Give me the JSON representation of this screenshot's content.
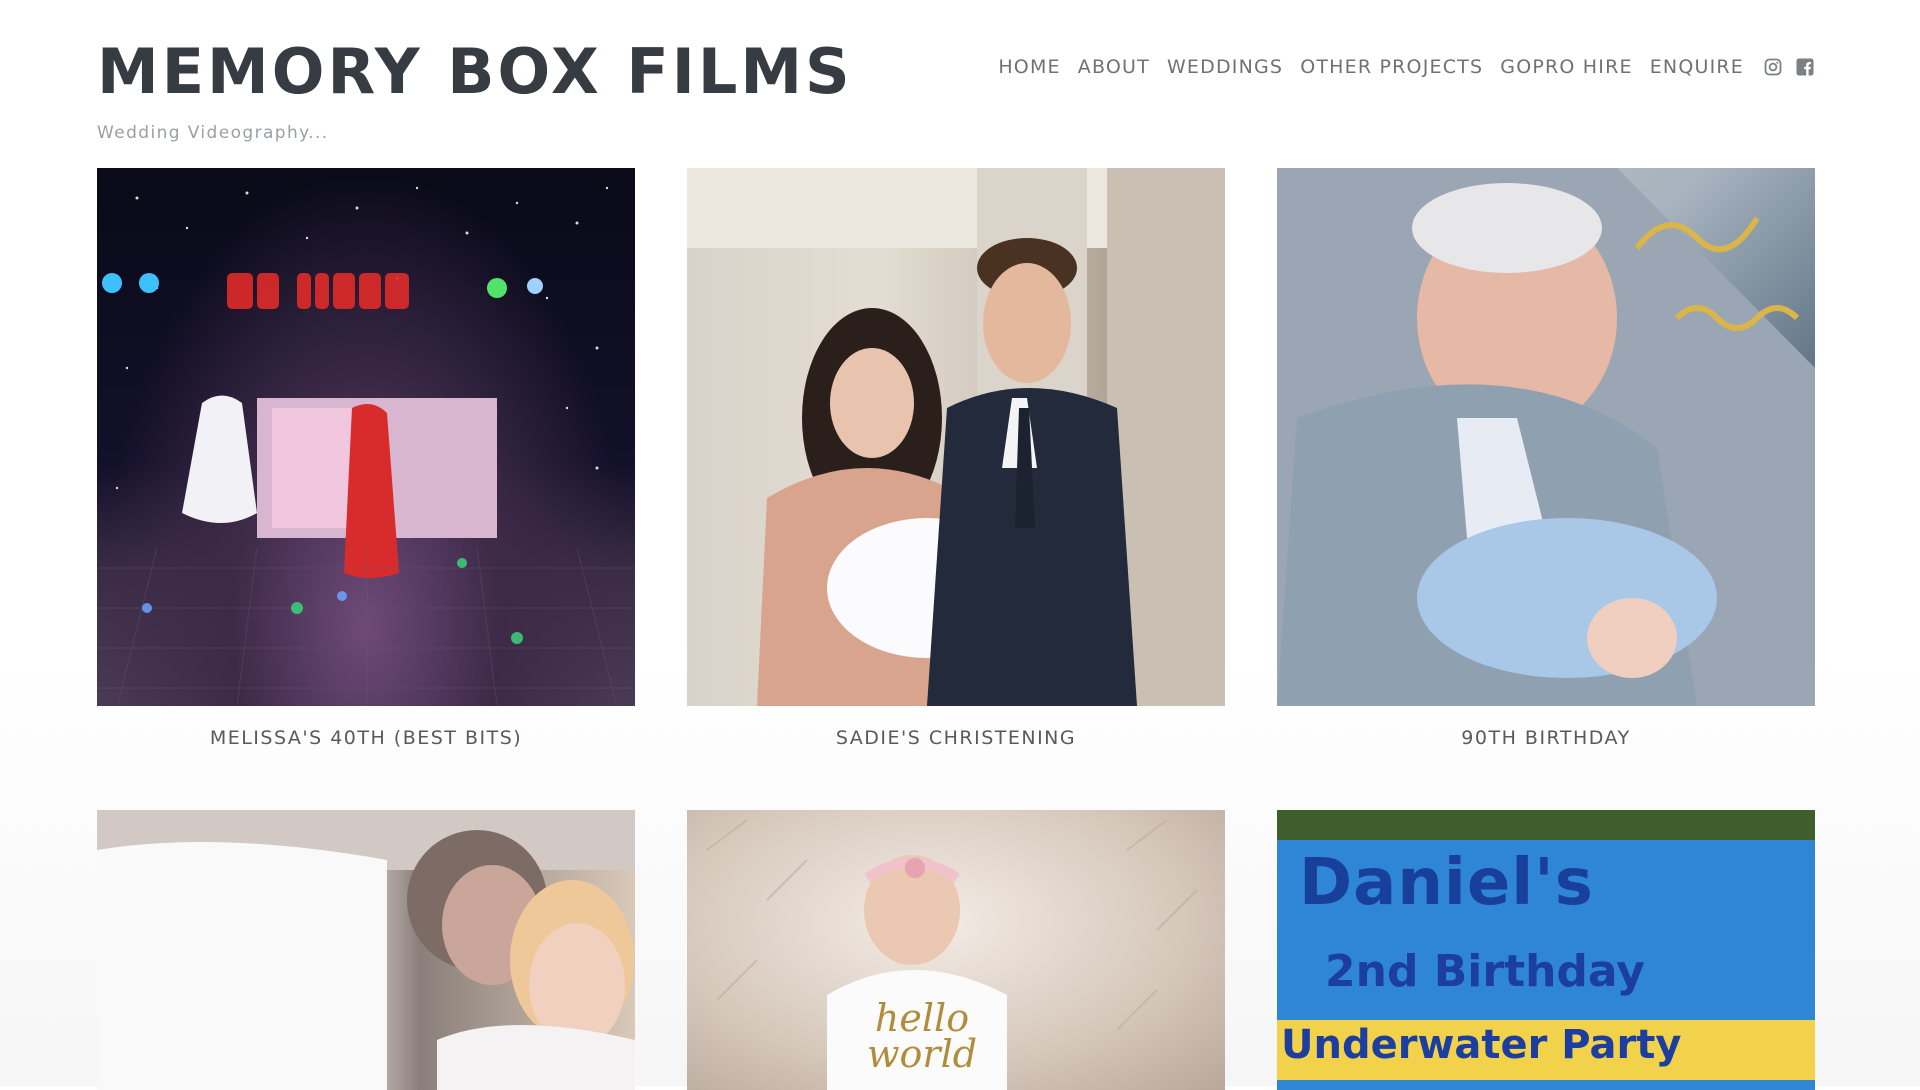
{
  "site": {
    "title": "MEMORY BOX FILMS",
    "tagline": "Wedding Videography..."
  },
  "nav": {
    "items": [
      "HOME",
      "ABOUT",
      "WEDDINGS",
      "OTHER PROJECTS",
      "GOPRO HIRE",
      "ENQUIRE"
    ],
    "social": [
      "instagram-icon",
      "facebook-icon"
    ]
  },
  "gallery": {
    "items": [
      {
        "caption": "MELISSA'S 40TH (BEST BITS)",
        "image": "dance-floor-party-photo",
        "overlay_text": "ME LISSA"
      },
      {
        "caption": "SADIE'S CHRISTENING",
        "image": "couple-with-baby-photo"
      },
      {
        "caption": "90TH BIRTHDAY",
        "image": "grandfather-with-baby-photo"
      },
      {
        "caption": "",
        "image": "grandmother-with-child-photo"
      },
      {
        "caption": "",
        "image": "newborn-on-rug-photo",
        "overlay_text": "hello world"
      },
      {
        "caption": "",
        "image": "birthday-banner-photo",
        "overlay_text": [
          "Daniel's",
          "2nd Birthday",
          "Underwater Party"
        ]
      }
    ]
  }
}
